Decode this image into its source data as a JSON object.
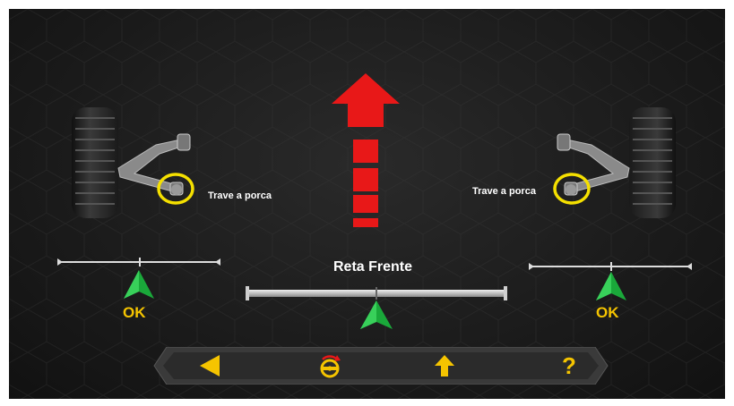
{
  "left_wheel": {
    "instruction": "Trave a porca",
    "status": "OK"
  },
  "right_wheel": {
    "instruction": "Trave a porca",
    "status": "OK"
  },
  "center": {
    "title": "Reta Frente"
  },
  "toolbar": {
    "buttons": [
      {
        "name": "back",
        "icon": "triangle-left-icon"
      },
      {
        "name": "steering",
        "icon": "steering-wheel-icon"
      },
      {
        "name": "up",
        "icon": "arrow-up-icon"
      },
      {
        "name": "help",
        "icon": "question-mark-icon",
        "label": "?"
      }
    ]
  },
  "colors": {
    "accent_yellow": "#f5c400",
    "arrow_red": "#e81818",
    "indicator_green": "#1aa83a",
    "background": "#1c1c1c"
  }
}
